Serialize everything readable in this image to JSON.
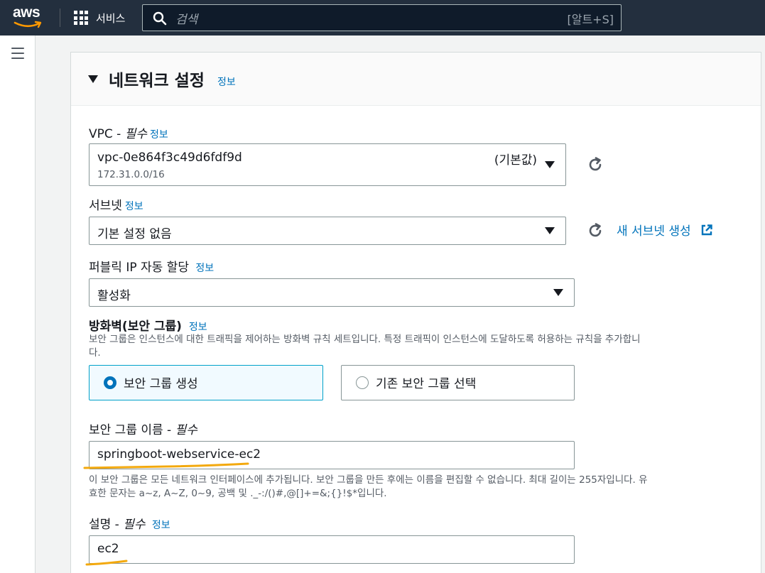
{
  "topnav": {
    "logo_text": "aws",
    "services_label": "서비스",
    "search_placeholder": "검색",
    "search_shortcut": "[알트+S]"
  },
  "panel": {
    "title": "네트워크 설정",
    "title_info": "정보",
    "vpc": {
      "label": "VPC -",
      "required": "필수",
      "info": "정보",
      "value": "vpc-0e864f3c49d6fdf9d",
      "cidr": "172.31.0.0/16",
      "tag": "(기본값)"
    },
    "subnet": {
      "label": "서브넷",
      "info": "정보",
      "value": "기본 설정 없음",
      "new_link": "새 서브넷 생성"
    },
    "public_ip": {
      "label": "퍼블릭 IP 자동 할당",
      "info": "정보",
      "value": "활성화"
    },
    "firewall": {
      "label": "방화벽(보안 그룹)",
      "info": "정보",
      "description_line1": "보안 그룹은 인스턴스에 대한 트래픽을 제어하는 방화벽 규칙 세트입니다. 특정 트래픽이 인스턴스에 도달하도록 허용하는 규칙을 추가합니",
      "description_line2": "다.",
      "option_create": "보안 그룹 생성",
      "option_existing": "기존 보안 그룹 선택",
      "selected": "create"
    },
    "sg_name": {
      "label": "보안 그룹 이름 -",
      "required": "필수",
      "value": "springboot-webservice-ec2",
      "help_line1": "이 보안 그룹은 모든 네트워크 인터페이스에 추가됩니다. 보안 그룹을 만든 후에는 이름을 편집할 수 없습니다. 최대 길이는 255자입니다. 유",
      "help_line2": "효한 문자는 a~z, A~Z, 0~9, 공백 및 ._-:/()#,@[]+=&;{}!$*입니다."
    },
    "description": {
      "label": "설명 -",
      "required": "필수",
      "info": "정보",
      "value": "ec2"
    }
  },
  "colors": {
    "nav_bg": "#232f3e",
    "link": "#0073bb",
    "highlight_underline": "#f3a90e",
    "selected_tile_border": "#00a1c9"
  }
}
